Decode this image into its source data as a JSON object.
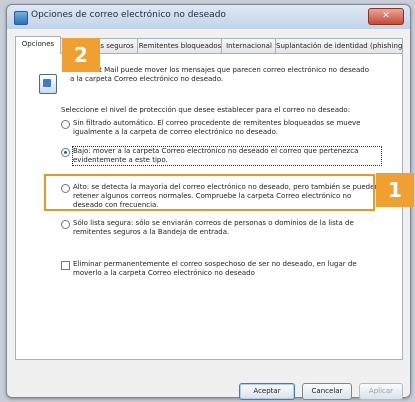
{
  "window": {
    "title": "Opciones de correo electrónico no deseado",
    "close_glyph": "✕"
  },
  "tabs": [
    {
      "label": "Opciones"
    },
    {
      "label": "Remitentes seguros"
    },
    {
      "label": "Remitentes bloqueados"
    },
    {
      "label": "Internacional"
    },
    {
      "label": "Suplantación de identidad (phishing)"
    }
  ],
  "panel": {
    "intro": "Microsoft Mail puede mover los mensajes que parecen correo electrónico no deseado a la carpeta Correo electrónico no deseado.",
    "prompt": "Seleccione el nivel de protección que desee establecer para el correo no deseado:",
    "options": [
      {
        "text": "Sin filtrado automático. El correo procedente de remitentes bloqueados se mueve igualmente a la carpeta de correo electrónico no deseado.",
        "checked": false
      },
      {
        "text": "Bajo: mover a la carpeta Correo electrónico no deseado el correo que pertenezca evidentemente a este tipo.",
        "checked": true
      },
      {
        "text": "Alto: se detecta la mayoría del correo electrónico no deseado, pero también se pueden retener algunos correos normales. Compruebe la carpeta Correo electrónico no deseado con frecuencia.",
        "checked": false
      },
      {
        "text": "Sólo lista segura: sólo se enviarán correos de personas o dominios de la lista de remitentes seguros a la Bandeja de entrada.",
        "checked": false
      }
    ],
    "delete_checkbox": "Eliminar permanentemente el correo sospechoso de ser no deseado, en lugar de moverlo a la carpeta Correo electrónico no deseado"
  },
  "badges": {
    "badge_tab": "2",
    "badge_option": "1"
  },
  "buttons": {
    "accept": "Aceptar",
    "cancel": "Cancelar",
    "apply": "Aplicar"
  },
  "colors": {
    "accent_badge": "#f0a030",
    "highlight_border": "#e8952a"
  }
}
